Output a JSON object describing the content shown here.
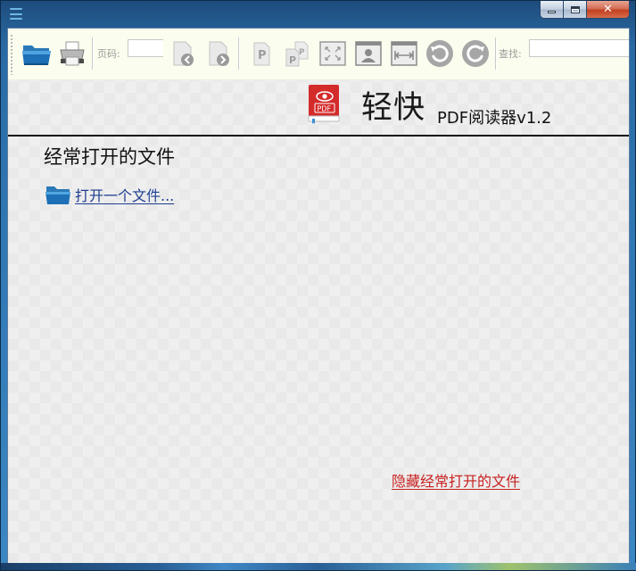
{
  "window": {
    "controls": {
      "minimize": "",
      "maximize": "",
      "close": "✕"
    }
  },
  "toolbar": {
    "page_label": "页码:",
    "page_value": "",
    "search_label": "查找:",
    "search_value": ""
  },
  "header": {
    "title": "轻快",
    "subtitle": "PDF阅读器v1.2",
    "icon_label": "PDF"
  },
  "recent": {
    "title": "经常打开的文件",
    "open_link": "打开一个文件...",
    "hide_link": "隐藏经常打开的文件"
  },
  "icons": [
    "app-menu-icon",
    "open-folder-icon",
    "print-icon",
    "prev-page-icon",
    "next-page-icon",
    "single-page-icon",
    "double-page-icon",
    "fullscreen-icon",
    "fit-page-icon",
    "fit-width-icon",
    "rotate-left-icon",
    "rotate-right-icon",
    "pdf-reader-logo-icon"
  ],
  "colors": {
    "link": "#1d3d8f",
    "hide_link": "#c8201f",
    "toolbar_bg": "#fbfdee",
    "logo_red": "#d42b2b"
  }
}
